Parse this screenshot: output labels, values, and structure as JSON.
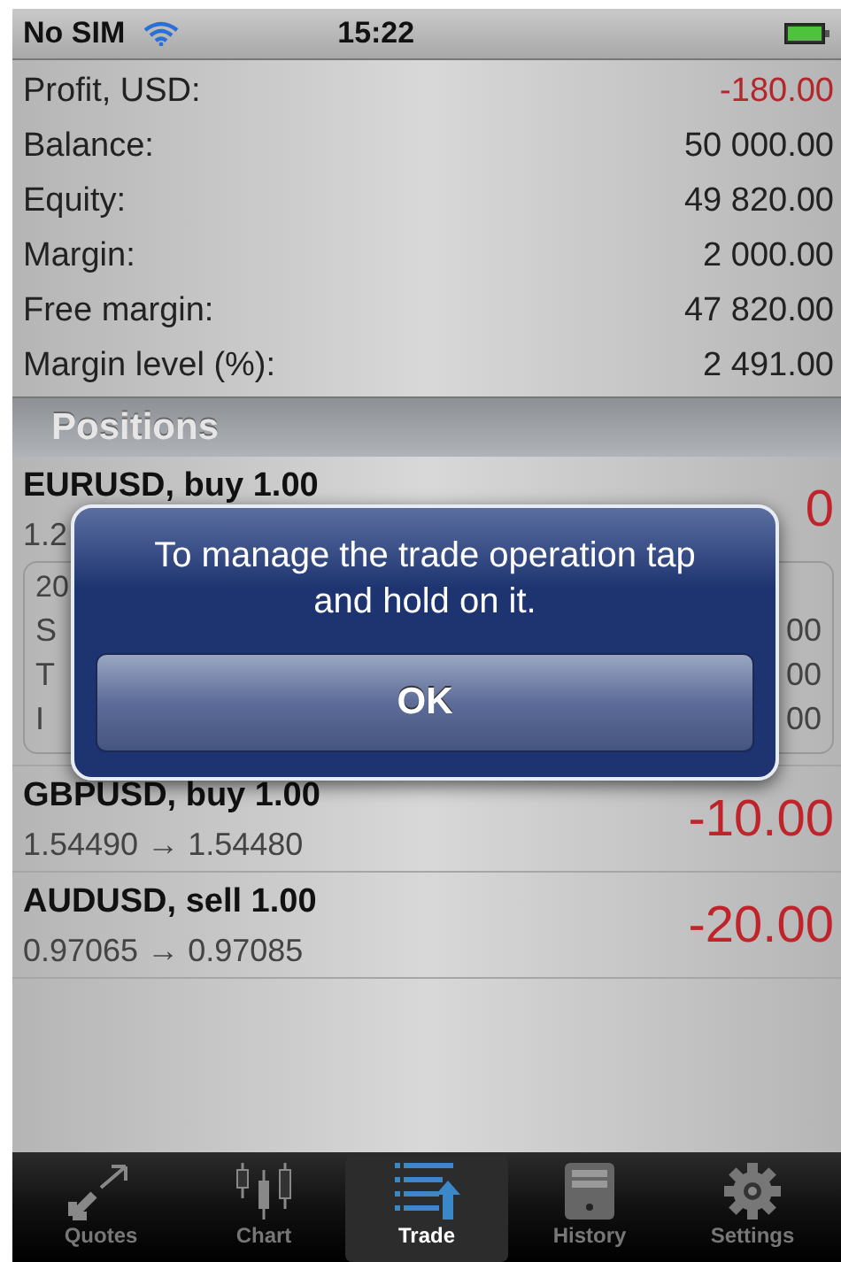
{
  "status_bar": {
    "carrier": "No SIM",
    "time": "15:22"
  },
  "account": [
    {
      "label": "Profit, USD:",
      "value": "-180.00",
      "negative": true
    },
    {
      "label": "Balance:",
      "value": "50 000.00",
      "negative": false
    },
    {
      "label": "Equity:",
      "value": "49 820.00",
      "negative": false
    },
    {
      "label": "Margin:",
      "value": "2 000.00",
      "negative": false
    },
    {
      "label": "Free margin:",
      "value": "47 820.00",
      "negative": false
    },
    {
      "label": "Margin level (%):",
      "value": "2 491.00",
      "negative": false
    }
  ],
  "positions_header": "Positions",
  "positions": [
    {
      "title": "EURUSD, buy 1.00",
      "prices": "1.2",
      "profit": "0",
      "expanded": true,
      "details": {
        "time": "20",
        "fields": [
          {
            "label": "S",
            "value": "00"
          },
          {
            "label": "T",
            "value": "00"
          },
          {
            "label": "I",
            "value": "00"
          }
        ]
      }
    },
    {
      "title": "GBPUSD, buy 1.00",
      "prices": "1.54490 → 1.54480",
      "profit": "-10.00",
      "expanded": false
    },
    {
      "title": "AUDUSD, sell 1.00",
      "prices": "0.97065 → 0.97085",
      "profit": "-20.00",
      "expanded": false
    }
  ],
  "alert": {
    "message": "To manage the trade operation tap and hold on it.",
    "button": "OK"
  },
  "tabs": [
    {
      "label": "Quotes",
      "selected": false
    },
    {
      "label": "Chart",
      "selected": false
    },
    {
      "label": "Trade",
      "selected": true
    },
    {
      "label": "History",
      "selected": false
    },
    {
      "label": "Settings",
      "selected": false
    }
  ]
}
